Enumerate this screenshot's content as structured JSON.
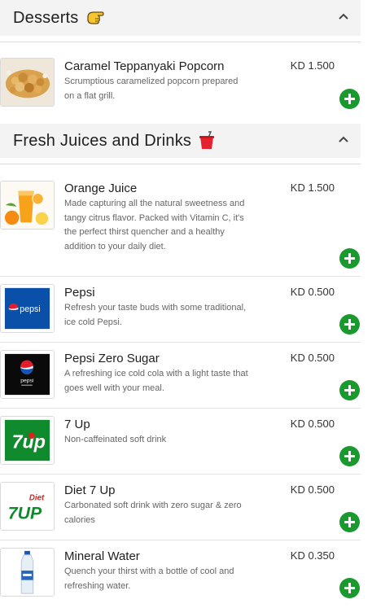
{
  "sections": [
    {
      "title": "Desserts",
      "emoji_icon": "pointing-hand-icon",
      "items": [
        {
          "name": "Caramel Teppanyaki Popcorn",
          "desc": "Scrumptious caramelized popcorn prepared on a flat grill.",
          "price": "KD 1.500",
          "image_icon": "popcorn-image"
        }
      ]
    },
    {
      "title": "Fresh Juices and Drinks",
      "emoji_icon": "drink-cup-icon",
      "items": [
        {
          "name": "Orange Juice",
          "desc": "Made capturing all the natural sweetness and tangy citrus flavor. Packed with Vitamin C, it's the perfect thirst quencher and a healthy addition to your daily diet.",
          "price": "KD 1.500",
          "image_icon": "orange-juice-image"
        },
        {
          "name": "Pepsi",
          "desc": "Refresh your taste buds with some traditional, ice cold Pepsi.",
          "price": "KD 0.500",
          "image_icon": "pepsi-logo",
          "logo_text": "pepsi"
        },
        {
          "name": "Pepsi Zero Sugar",
          "desc": "A refreshing ice cold cola with a light taste that goes well with your meal.",
          "price": "KD 0.500",
          "image_icon": "pepsi-zero-logo",
          "logo_text": "pepsi"
        },
        {
          "name": "7 Up",
          "desc": "Non-caffeinated soft drink",
          "price": "KD 0.500",
          "image_icon": "7up-logo",
          "logo_text": "7up"
        },
        {
          "name": "Diet 7 Up",
          "desc": "Carbonated soft drink with zero sugar & zero calories",
          "price": "KD 0.500",
          "image_icon": "diet-7up-logo",
          "logo_text_1": "Diet",
          "logo_text_2": "7UP"
        },
        {
          "name": "Mineral Water",
          "desc": "Quench your thirst with a bottle of cool and refreshing water.",
          "price": "KD 0.350",
          "image_icon": "water-bottle-image"
        }
      ]
    }
  ],
  "colors": {
    "add_button": "#1a9a2e",
    "section_header_bg": "#f3f3f3",
    "pepsi_blue": "#0a4fa8",
    "sevenup_green": "#0f8a2c",
    "diet_red": "#d9251d"
  }
}
